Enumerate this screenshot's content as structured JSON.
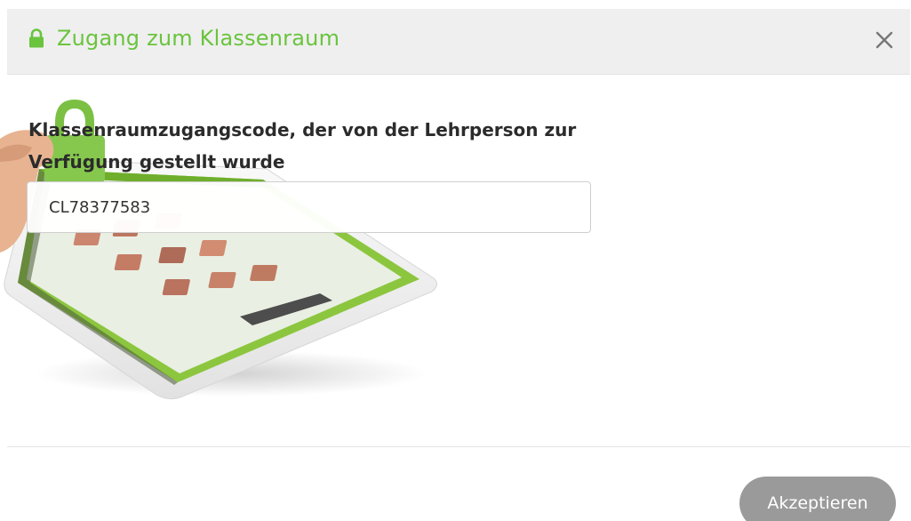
{
  "dialog": {
    "title": "Zugang zum Klassenraum",
    "title_icon": "lock-icon",
    "close_icon": "close-icon",
    "accent_color": "#6ac43e"
  },
  "form": {
    "label": "Klassenraumzugangscode, der von der Lehrperson zur Verfügung gestellt wurde",
    "code_value": "CL78377583",
    "illustration": "tablet-with-padlock-image"
  },
  "footer": {
    "accept_label": "Akzeptieren",
    "accept_color": "#9a9a9a"
  }
}
